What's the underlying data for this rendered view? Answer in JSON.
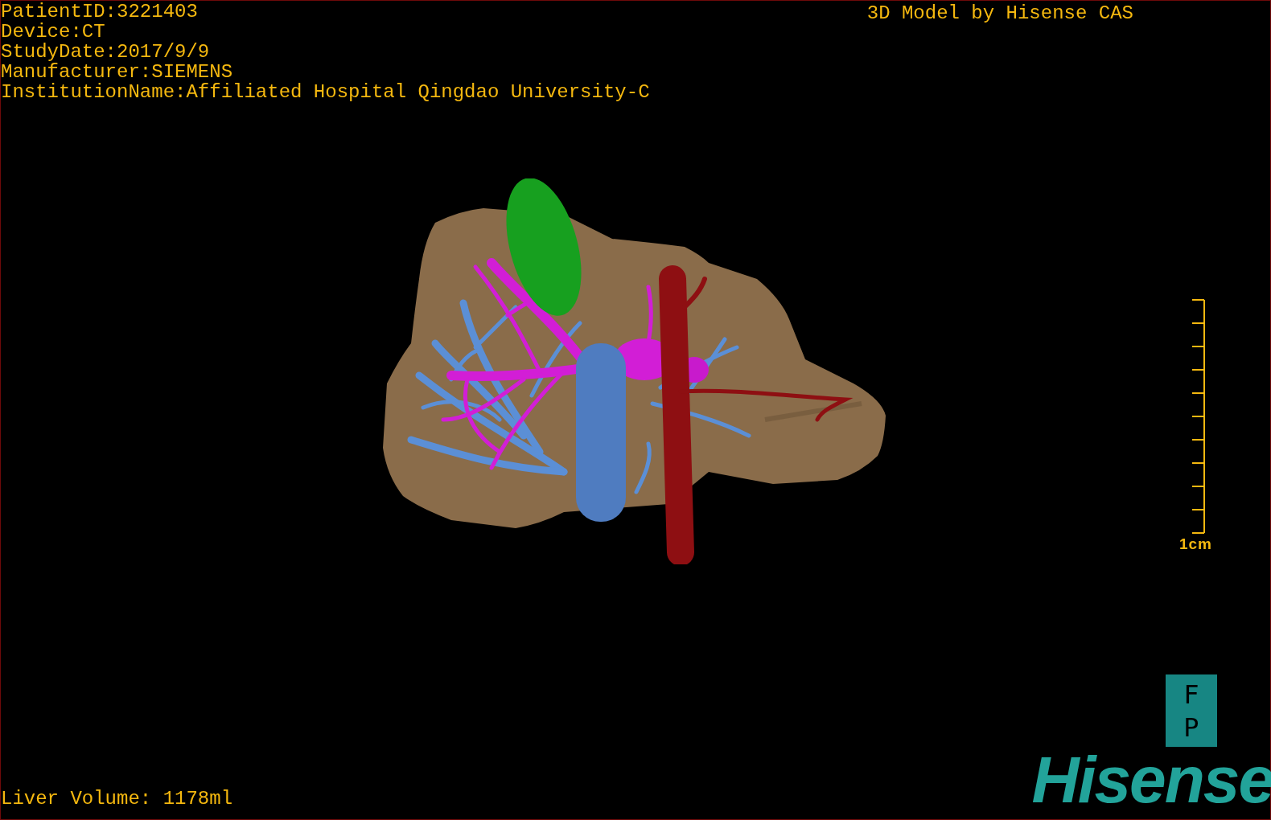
{
  "study_info": [
    "PatientID:3221403",
    "Device:CT",
    "StudyDate:2017/9/9",
    "Manufacturer:SIEMENS",
    "InstitutionName:Affiliated Hospital Qingdao University-C"
  ],
  "title": "3D Model by Hisense CAS",
  "scale": {
    "label": "1cm"
  },
  "orientation": [
    "F",
    "P"
  ],
  "liver_volume": "Liver Volume: 1178ml",
  "logo": "Hisense"
}
